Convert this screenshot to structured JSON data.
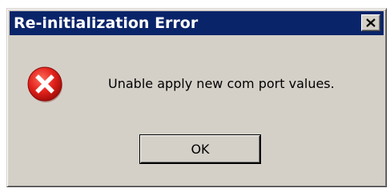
{
  "window": {
    "title": "Re-initialization Error",
    "close_icon": "close-icon",
    "titlebar_color": "#0a246a"
  },
  "content": {
    "icon": "error-icon",
    "icon_color": "#e1211b",
    "message": "Unable apply new com port values."
  },
  "buttons": {
    "ok_label": "OK"
  }
}
